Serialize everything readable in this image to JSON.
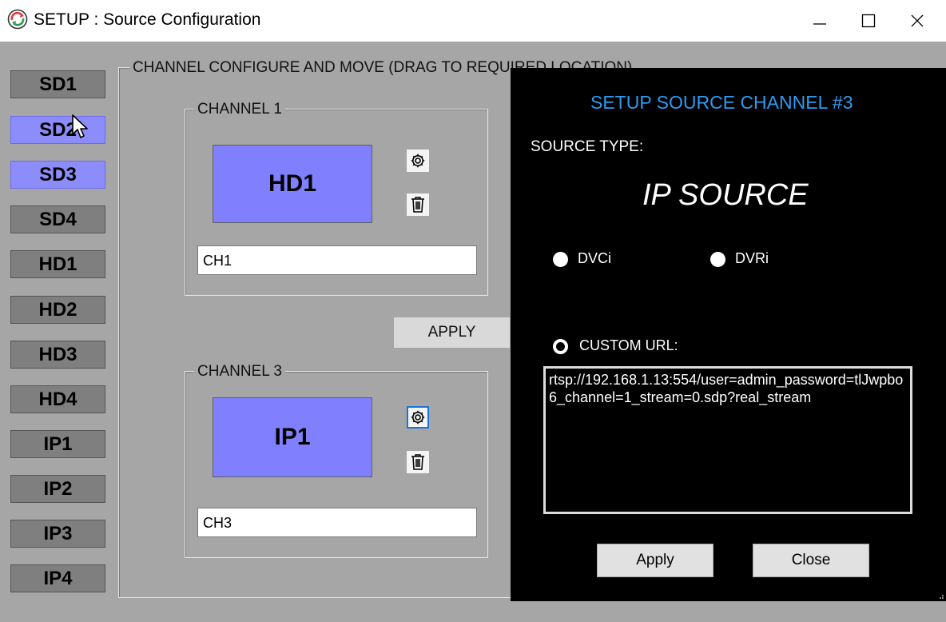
{
  "window": {
    "title": "SETUP : Source Configuration",
    "minimize_glyph": "—",
    "maximize_glyph": "☐",
    "close_glyph": "✕"
  },
  "sources": [
    {
      "label": "SD1",
      "selected": false
    },
    {
      "label": "SD2",
      "selected": true
    },
    {
      "label": "SD3",
      "selected": true
    },
    {
      "label": "SD4",
      "selected": false
    },
    {
      "label": "HD1",
      "selected": false
    },
    {
      "label": "HD2",
      "selected": false
    },
    {
      "label": "HD3",
      "selected": false
    },
    {
      "label": "HD4",
      "selected": false
    },
    {
      "label": "IP1",
      "selected": false
    },
    {
      "label": "IP2",
      "selected": false
    },
    {
      "label": "IP3",
      "selected": false
    },
    {
      "label": "IP4",
      "selected": false
    }
  ],
  "main": {
    "group_label": "CHANNEL CONFIGURE AND MOVE (DRAG TO REQUIRED LOCATION)",
    "apply_label": "APPLY",
    "channels": [
      {
        "label": "CHANNEL 1",
        "source": "HD1",
        "name": "CH1",
        "settings_icon": "gear-icon",
        "delete_icon": "trash-icon"
      },
      {
        "label": "CHANNEL 3",
        "source": "IP1",
        "name": "CH3",
        "settings_icon": "gear-icon",
        "delete_icon": "trash-icon"
      }
    ]
  },
  "popup": {
    "title": "SETUP SOURCE CHANNEL #3",
    "source_type_label": "SOURCE TYPE:",
    "source_type_value": "IP SOURCE",
    "options": {
      "dvci": "DVCi",
      "dvri": "DVRi",
      "custom_url": "CUSTOM URL:"
    },
    "selected_option": "custom_url",
    "custom_url_value": "rtsp://192.168.1.13:554/user=admin_password=tlJwpbo6_channel=1_stream=0.sdp?real_stream",
    "apply_label": "Apply",
    "close_label": "Close"
  },
  "colors": {
    "client_bg": "#a6a6a6",
    "selected_source": "#8c8cfa",
    "source_tile": "#8080ff",
    "popup_bg": "#000000",
    "popup_title": "#2d9bf0"
  }
}
